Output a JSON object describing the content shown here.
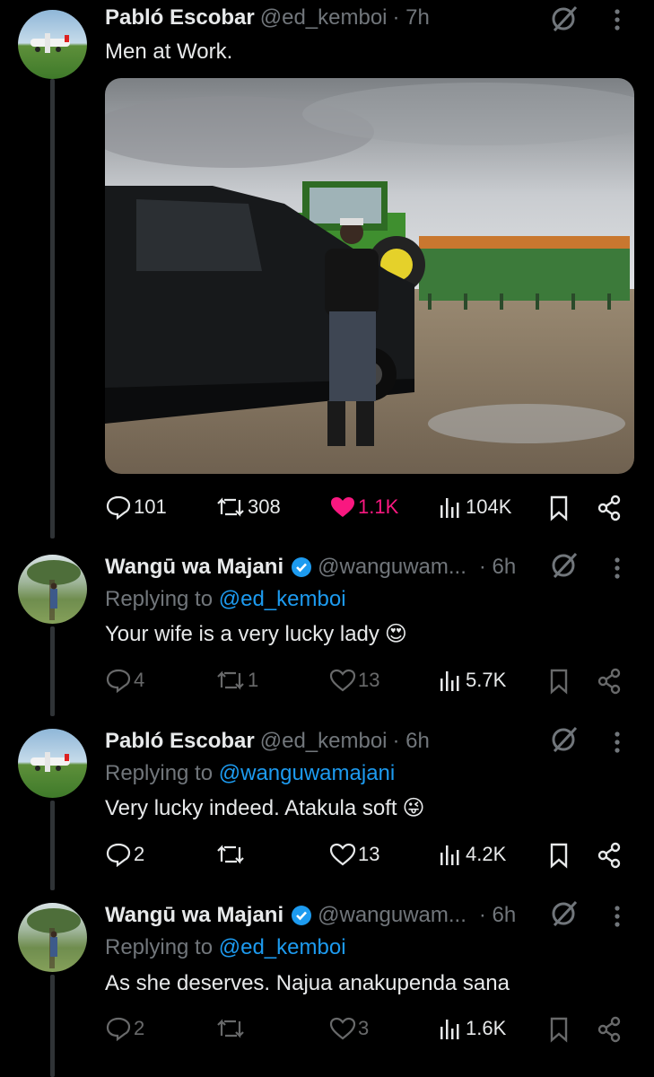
{
  "colors": {
    "background": "#000000",
    "text": "#e7e9ea",
    "muted": "#71767b",
    "link": "#1d9bf0",
    "like": "#f91880",
    "verified": "#1d9bf0"
  },
  "tweets": [
    {
      "name": "Pabló Escobar",
      "handle": "@ed_kemboi",
      "time": "· 7h",
      "text": "Men at Work.",
      "avatar_icon": "airplane-avatar",
      "media": "photo-man-tractor-car",
      "replies": "101",
      "reposts": "308",
      "likes": "1.1K",
      "views": "104K"
    },
    {
      "name": "Wangū wa Majani",
      "handle": "@wanguwam...",
      "time": "· 6h",
      "reply_prefix": "Replying to ",
      "reply_to": "@ed_kemboi",
      "text": "Your wife is a very lucky lady",
      "emoji": "😍",
      "avatar_icon": "woman-field-avatar",
      "replies": "4",
      "reposts": "1",
      "likes": "13",
      "views": "5.7K"
    },
    {
      "name": "Pabló Escobar",
      "handle": "@ed_kemboi",
      "time": "· 6h",
      "reply_prefix": "Replying to ",
      "reply_to": "@wanguwamajani",
      "text": "Very lucky indeed. Atakula soft",
      "emoji": "😜",
      "avatar_icon": "airplane-avatar",
      "replies": "2",
      "reposts": "",
      "likes": "13",
      "views": "4.2K"
    },
    {
      "name": "Wangū wa Majani",
      "handle": "@wanguwam...",
      "time": "· 6h",
      "reply_prefix": "Replying to ",
      "reply_to": "@ed_kemboi",
      "text": "As she deserves. Najua anakupenda sana",
      "avatar_icon": "woman-field-avatar",
      "replies": "2",
      "reposts": "",
      "likes": "3",
      "views": "1.6K"
    }
  ]
}
